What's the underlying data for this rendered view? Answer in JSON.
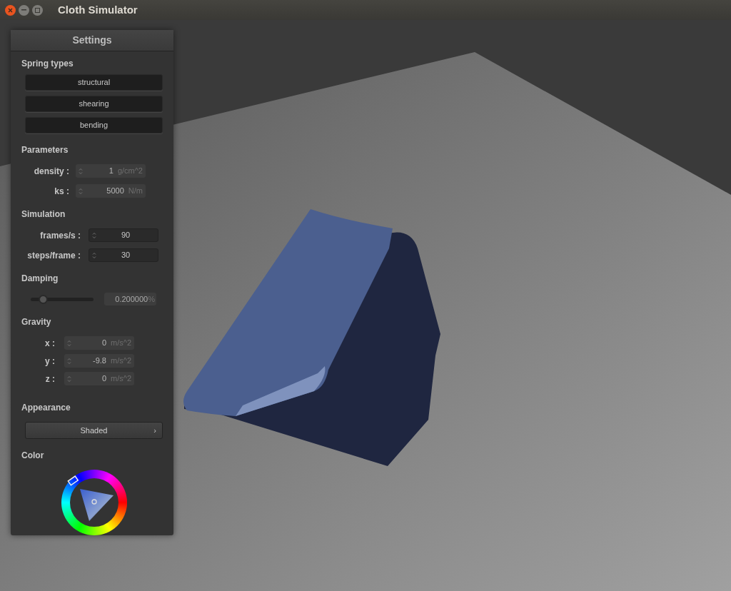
{
  "window": {
    "title": "Cloth Simulator"
  },
  "panel": {
    "title": "Settings",
    "sections": [
      {
        "kind": "buttons",
        "heading": "Spring types",
        "buttons": [
          "structural",
          "shearing",
          "bending"
        ]
      },
      {
        "kind": "fields",
        "heading": "Parameters",
        "items": [
          {
            "label": "density :",
            "value": "1",
            "unit": "g/cm^2",
            "disabled": true
          },
          {
            "label": "ks :",
            "value": "5000",
            "unit": "N/m",
            "disabled": true
          }
        ]
      },
      {
        "kind": "fields",
        "heading": "Simulation",
        "items": [
          {
            "label": "frames/s :",
            "value": "90",
            "disabled": false
          },
          {
            "label": "steps/frame :",
            "value": "30",
            "disabled": false
          }
        ]
      },
      {
        "kind": "slider",
        "heading": "Damping",
        "level": 0.2,
        "reading": "0.200000",
        "unit": "%"
      },
      {
        "kind": "fields",
        "heading": "Gravity",
        "items": [
          {
            "label": "x :",
            "value": "0",
            "unit": "m/s^2",
            "disabled": true
          },
          {
            "label": "y :",
            "value": "-9.8",
            "unit": "m/s^2",
            "disabled": true
          },
          {
            "label": "z :",
            "value": "0",
            "unit": "m/s^2",
            "disabled": true
          }
        ]
      },
      {
        "kind": "dropdown",
        "heading": "Appearance",
        "value": "Shaded",
        "arrow": "›"
      },
      {
        "kind": "color_wheel",
        "heading": "Color"
      }
    ]
  }
}
